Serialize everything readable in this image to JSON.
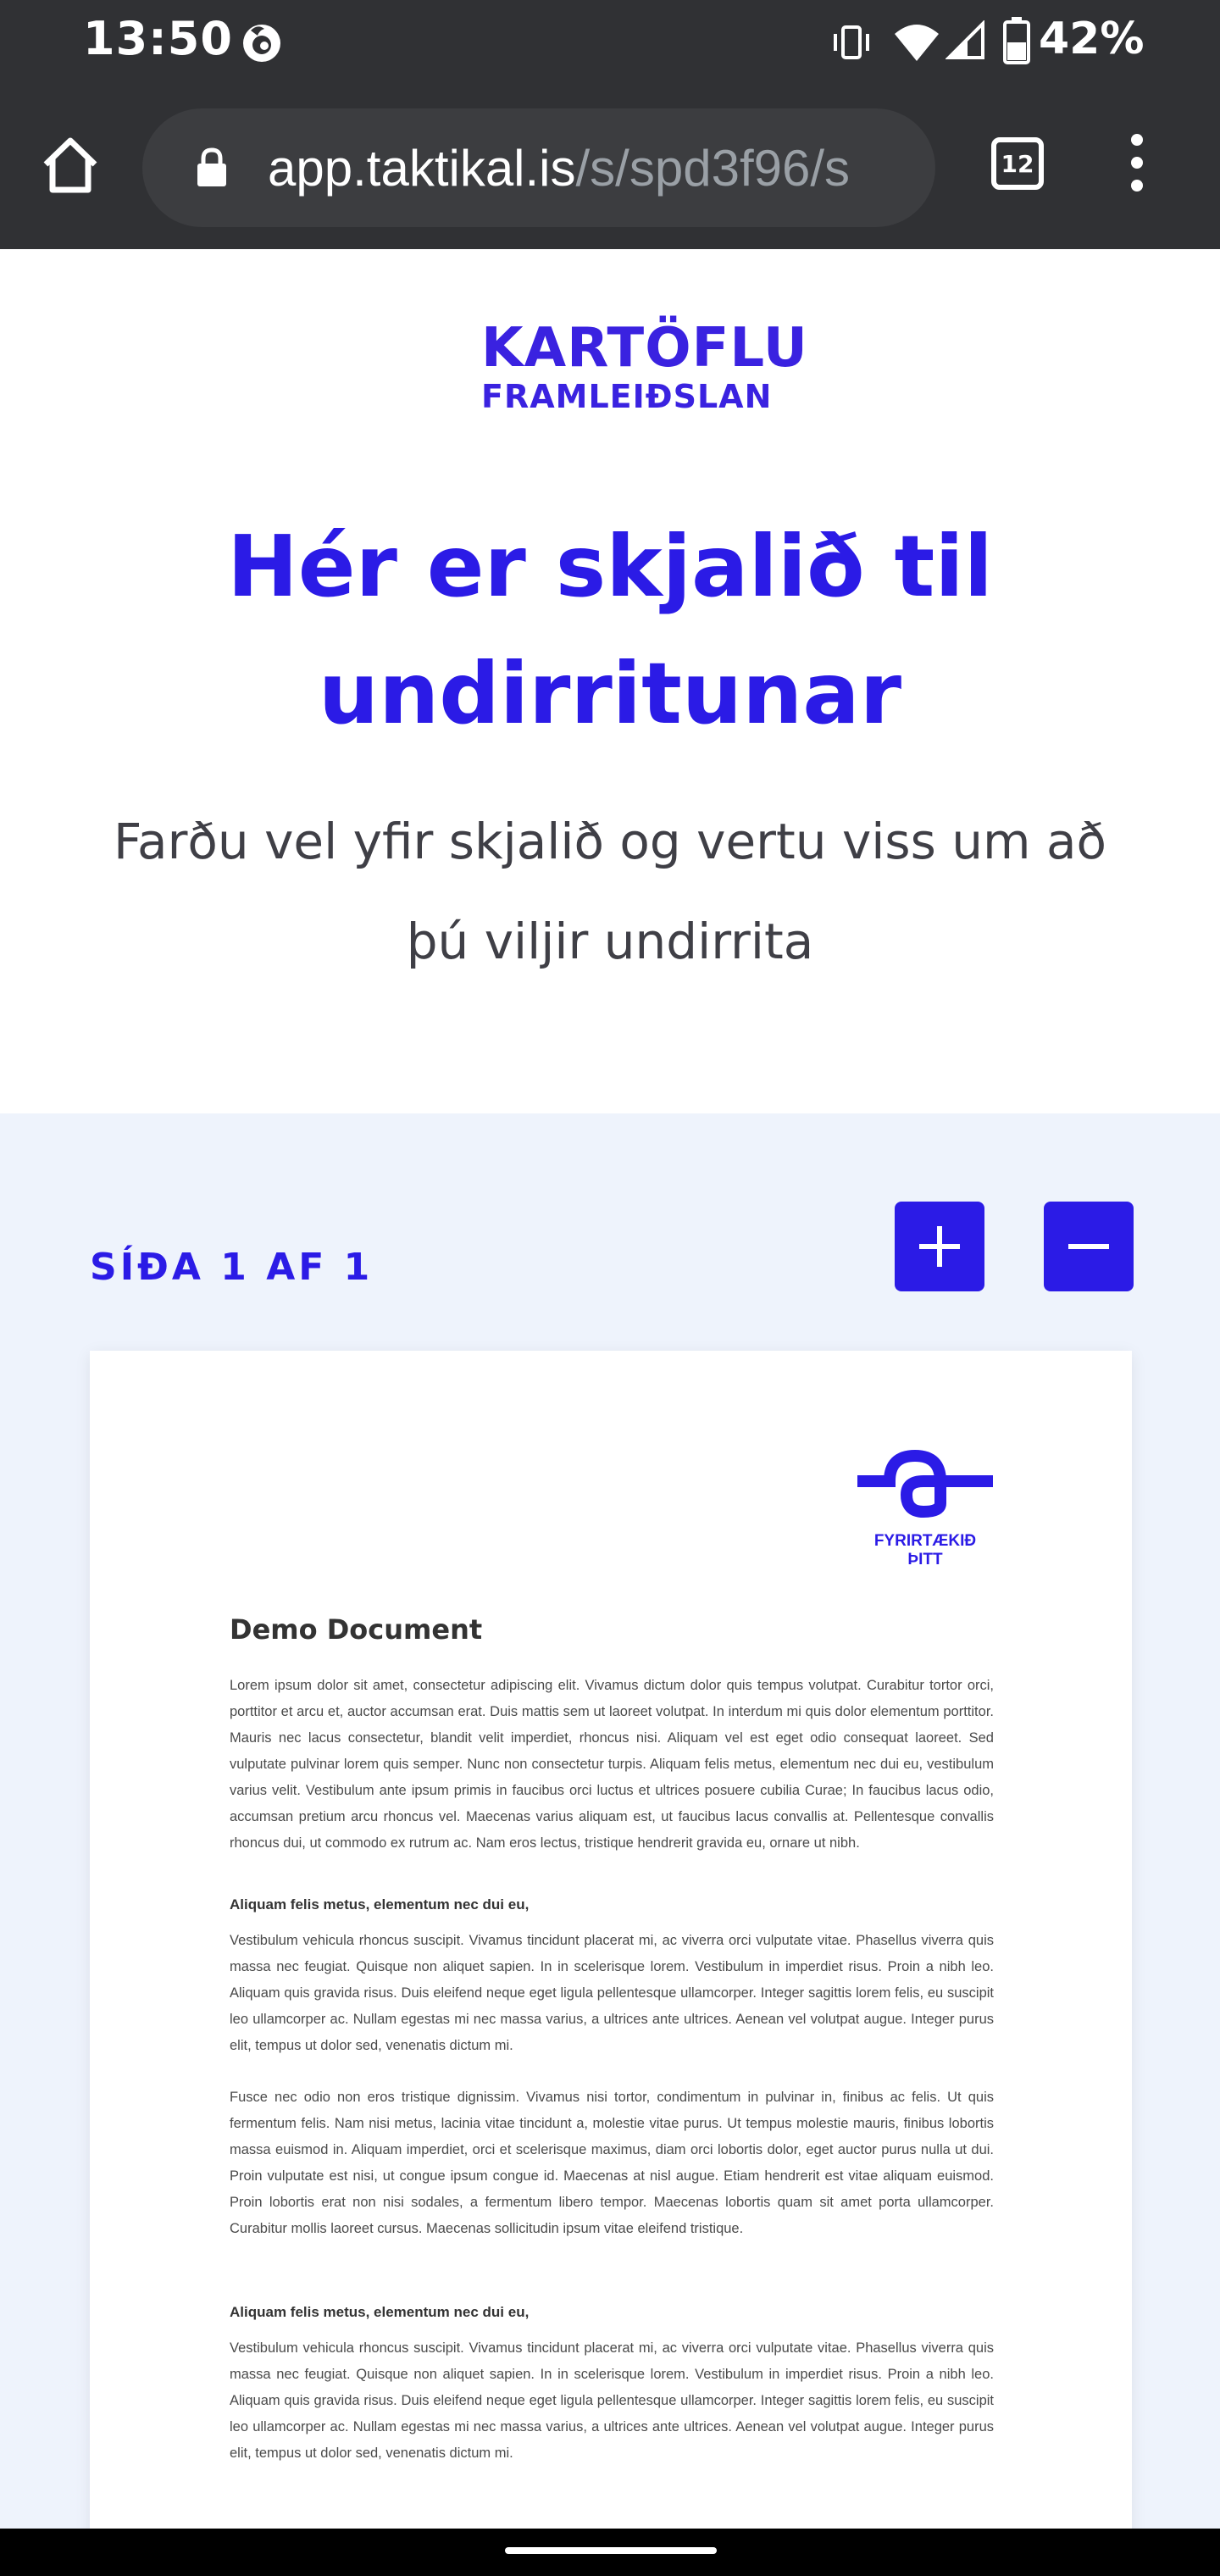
{
  "status_bar": {
    "time": "13:50",
    "battery": "42%",
    "icons": [
      "firefox-icon",
      "vibrate-icon",
      "wifi-icon",
      "signal-icon",
      "battery-icon"
    ]
  },
  "browser": {
    "url_host": "app.taktikal.is",
    "url_path": "/s/spd3f96/s",
    "tab_count": "12"
  },
  "header": {
    "logo_line1": "KARTÖFLU",
    "logo_line2": "FRAMLEIÐSLAN",
    "title": "Hér er skjalið til undirritunar",
    "subtitle": "Farðu vel yfir skjalið og vertu viss um að þú viljir undirrita"
  },
  "viewer": {
    "page_counter": "SÍÐA 1 AF 1",
    "zoom_in_icon": "plus-icon",
    "zoom_out_icon": "minus-icon"
  },
  "document": {
    "company_name": "FYRIRTÆKIÐ ÞITT",
    "title": "Demo Document",
    "intro": "Lorem ipsum dolor sit amet, consectetur adipiscing elit. Vivamus dictum dolor quis tempus volutpat. Curabitur tortor orci, porttitor et arcu et, auctor accumsan erat. Duis mattis sem ut laoreet volutpat. In interdum mi quis dolor elementum porttitor. Mauris nec lacus consectetur, blandit velit imperdiet, rhoncus nisi. Aliquam vel est eget odio consequat laoreet. Sed vulputate pulvinar lorem quis semper. Nunc non consectetur turpis. Aliquam felis metus, elementum nec dui eu, vestibulum varius velit. Vestibulum ante ipsum primis in faucibus orci luctus et ultrices posuere cubilia Curae; In faucibus lacus odio, accumsan pretium arcu rhoncus vel. Maecenas varius aliquam est, ut faucibus lacus convallis at. Pellentesque convallis rhoncus dui, ut commodo ex rutrum ac. Nam eros lectus, tristique hendrerit gravida eu, ornare ut nibh.",
    "section1_heading": "Aliquam felis metus, elementum nec dui eu,",
    "section1_p1": "Vestibulum vehicula rhoncus suscipit. Vivamus tincidunt placerat mi, ac viverra orci vulputate vitae. Phasellus viverra quis massa nec feugiat. Quisque non aliquet sapien. In in scelerisque lorem. Vestibulum in imperdiet risus. Proin a nibh leo. Aliquam quis gravida risus. Duis eleifend neque eget ligula pellentesque ullamcorper. Integer sagittis lorem felis, eu suscipit leo ullamcorper ac. Nullam egestas mi nec massa varius, a ultrices ante ultrices. Aenean vel volutpat augue. Integer purus elit, tempus ut dolor sed, venenatis dictum mi.",
    "section1_p2": "Fusce nec odio non eros tristique dignissim. Vivamus nisi tortor, condimentum in pulvinar in, finibus ac felis. Ut quis fermentum felis. Nam nisi metus, lacinia vitae tincidunt a, molestie vitae purus. Ut tempus molestie mauris, finibus lobortis massa euismod in. Aliquam imperdiet, orci et scelerisque maximus, diam orci lobortis dolor, eget auctor purus nulla ut dui. Proin vulputate est nisi, ut congue ipsum congue id. Maecenas at nisl augue. Etiam hendrerit est vitae aliquam euismod. Proin lobortis erat non nisi sodales, a fermentum libero tempor. Maecenas lobortis quam sit amet porta ullamcorper. Curabitur mollis laoreet cursus. Maecenas sollicitudin ipsum vitae eleifend tristique.",
    "section2_heading": "Aliquam felis metus, elementum nec dui eu,",
    "section2_p1": "Vestibulum vehicula rhoncus suscipit. Vivamus tincidunt placerat mi, ac viverra orci vulputate vitae. Phasellus viverra quis massa nec feugiat. Quisque non aliquet sapien. In in scelerisque lorem. Vestibulum in imperdiet risus. Proin a nibh leo. Aliquam quis gravida risus. Duis eleifend neque eget ligula pellentesque ullamcorper. Integer sagittis lorem felis, eu suscipit leo ullamcorper ac. Nullam egestas mi nec massa varius, a ultrices ante ultrices. Aenean vel volutpat augue. Integer purus elit, tempus ut dolor sed, venenatis dictum mi."
  },
  "colors": {
    "brand_blue": "#2b1be6",
    "logo_green": "#5fd39a",
    "viewer_bg": "#eef3fc",
    "chrome_bg": "#303134"
  }
}
